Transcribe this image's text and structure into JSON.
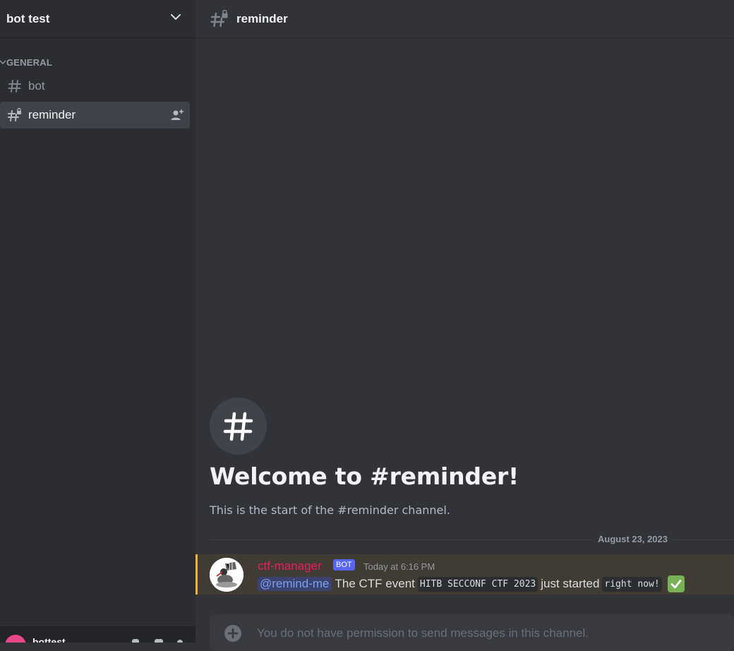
{
  "server": {
    "name": "bot test"
  },
  "sidebar": {
    "category": "GENERAL",
    "channels": [
      {
        "name": "bot",
        "type": "text",
        "active": false
      },
      {
        "name": "reminder",
        "type": "locked-text",
        "active": true
      }
    ]
  },
  "user_panel": {
    "username": "bottest"
  },
  "channel": {
    "name": "reminder"
  },
  "welcome": {
    "title": "Welcome to #reminder!",
    "subtitle": "This is the start of the #reminder channel."
  },
  "date_divider": "August 23, 2023",
  "message": {
    "author": "ctf-manager",
    "author_color": "#e91e63",
    "tag": "BOT",
    "timestamp": "Today at 6:16 PM",
    "mention": "@remind-me",
    "text_1": "The CTF event",
    "code_1": "HITB SECCONF CTF 2023",
    "text_2": "just started",
    "code_2": "right now!",
    "emoji": "white-check-mark"
  },
  "composer": {
    "placeholder": "You do not have permission to send messages in this channel."
  },
  "colors": {
    "sidebar_bg": "#2b2d31",
    "main_bg": "#313338",
    "highlight_bar": "#f0b232",
    "bot_tag": "#5865f2"
  }
}
